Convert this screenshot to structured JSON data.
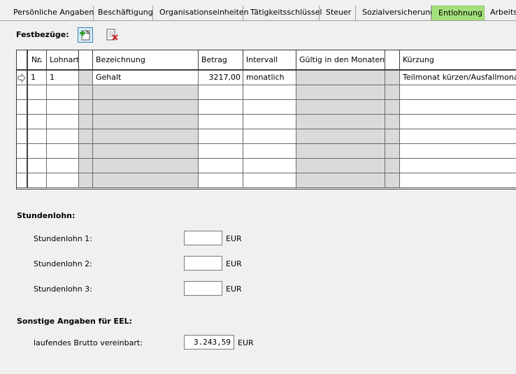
{
  "tabs": [
    {
      "label": "Persönliche Angaben"
    },
    {
      "label": "Beschäftigung"
    },
    {
      "label": "Organisationseinheiten"
    },
    {
      "label": "Tätigkeitsschlüssel"
    },
    {
      "label": "Steuer"
    },
    {
      "label": "Sozialversicherung"
    },
    {
      "label": "Entlohnung",
      "active": true
    },
    {
      "label": "Arbeitsz"
    }
  ],
  "festbezuege": {
    "label": "Festbezüge:",
    "columns": [
      "Nr.",
      "Lohnart",
      "",
      "Bezeichnung",
      "Betrag",
      "Intervall",
      "Gültig in den Monaten",
      "",
      "Kürzung"
    ],
    "rows": [
      {
        "nr": "1",
        "lohnart": "1",
        "bezeichnung": "Gehalt",
        "betrag": "3217,00",
        "intervall": "monatlich",
        "monate": "",
        "kuerzung": "Teilmonat kürzen/Ausfallmonat kür"
      }
    ]
  },
  "stundenlohn": {
    "label": "Stundenlohn:",
    "items": [
      {
        "label": "Stundenlohn 1:",
        "value": "",
        "unit": "EUR"
      },
      {
        "label": "Stundenlohn 2:",
        "value": "",
        "unit": "EUR"
      },
      {
        "label": "Stundenlohn 3:",
        "value": "",
        "unit": "EUR"
      }
    ]
  },
  "sonstige": {
    "label": "Sonstige Angaben für EEL:",
    "brutto_label": "laufendes Brutto vereinbart:",
    "brutto_value": "3.243,59",
    "brutto_unit": "EUR"
  }
}
